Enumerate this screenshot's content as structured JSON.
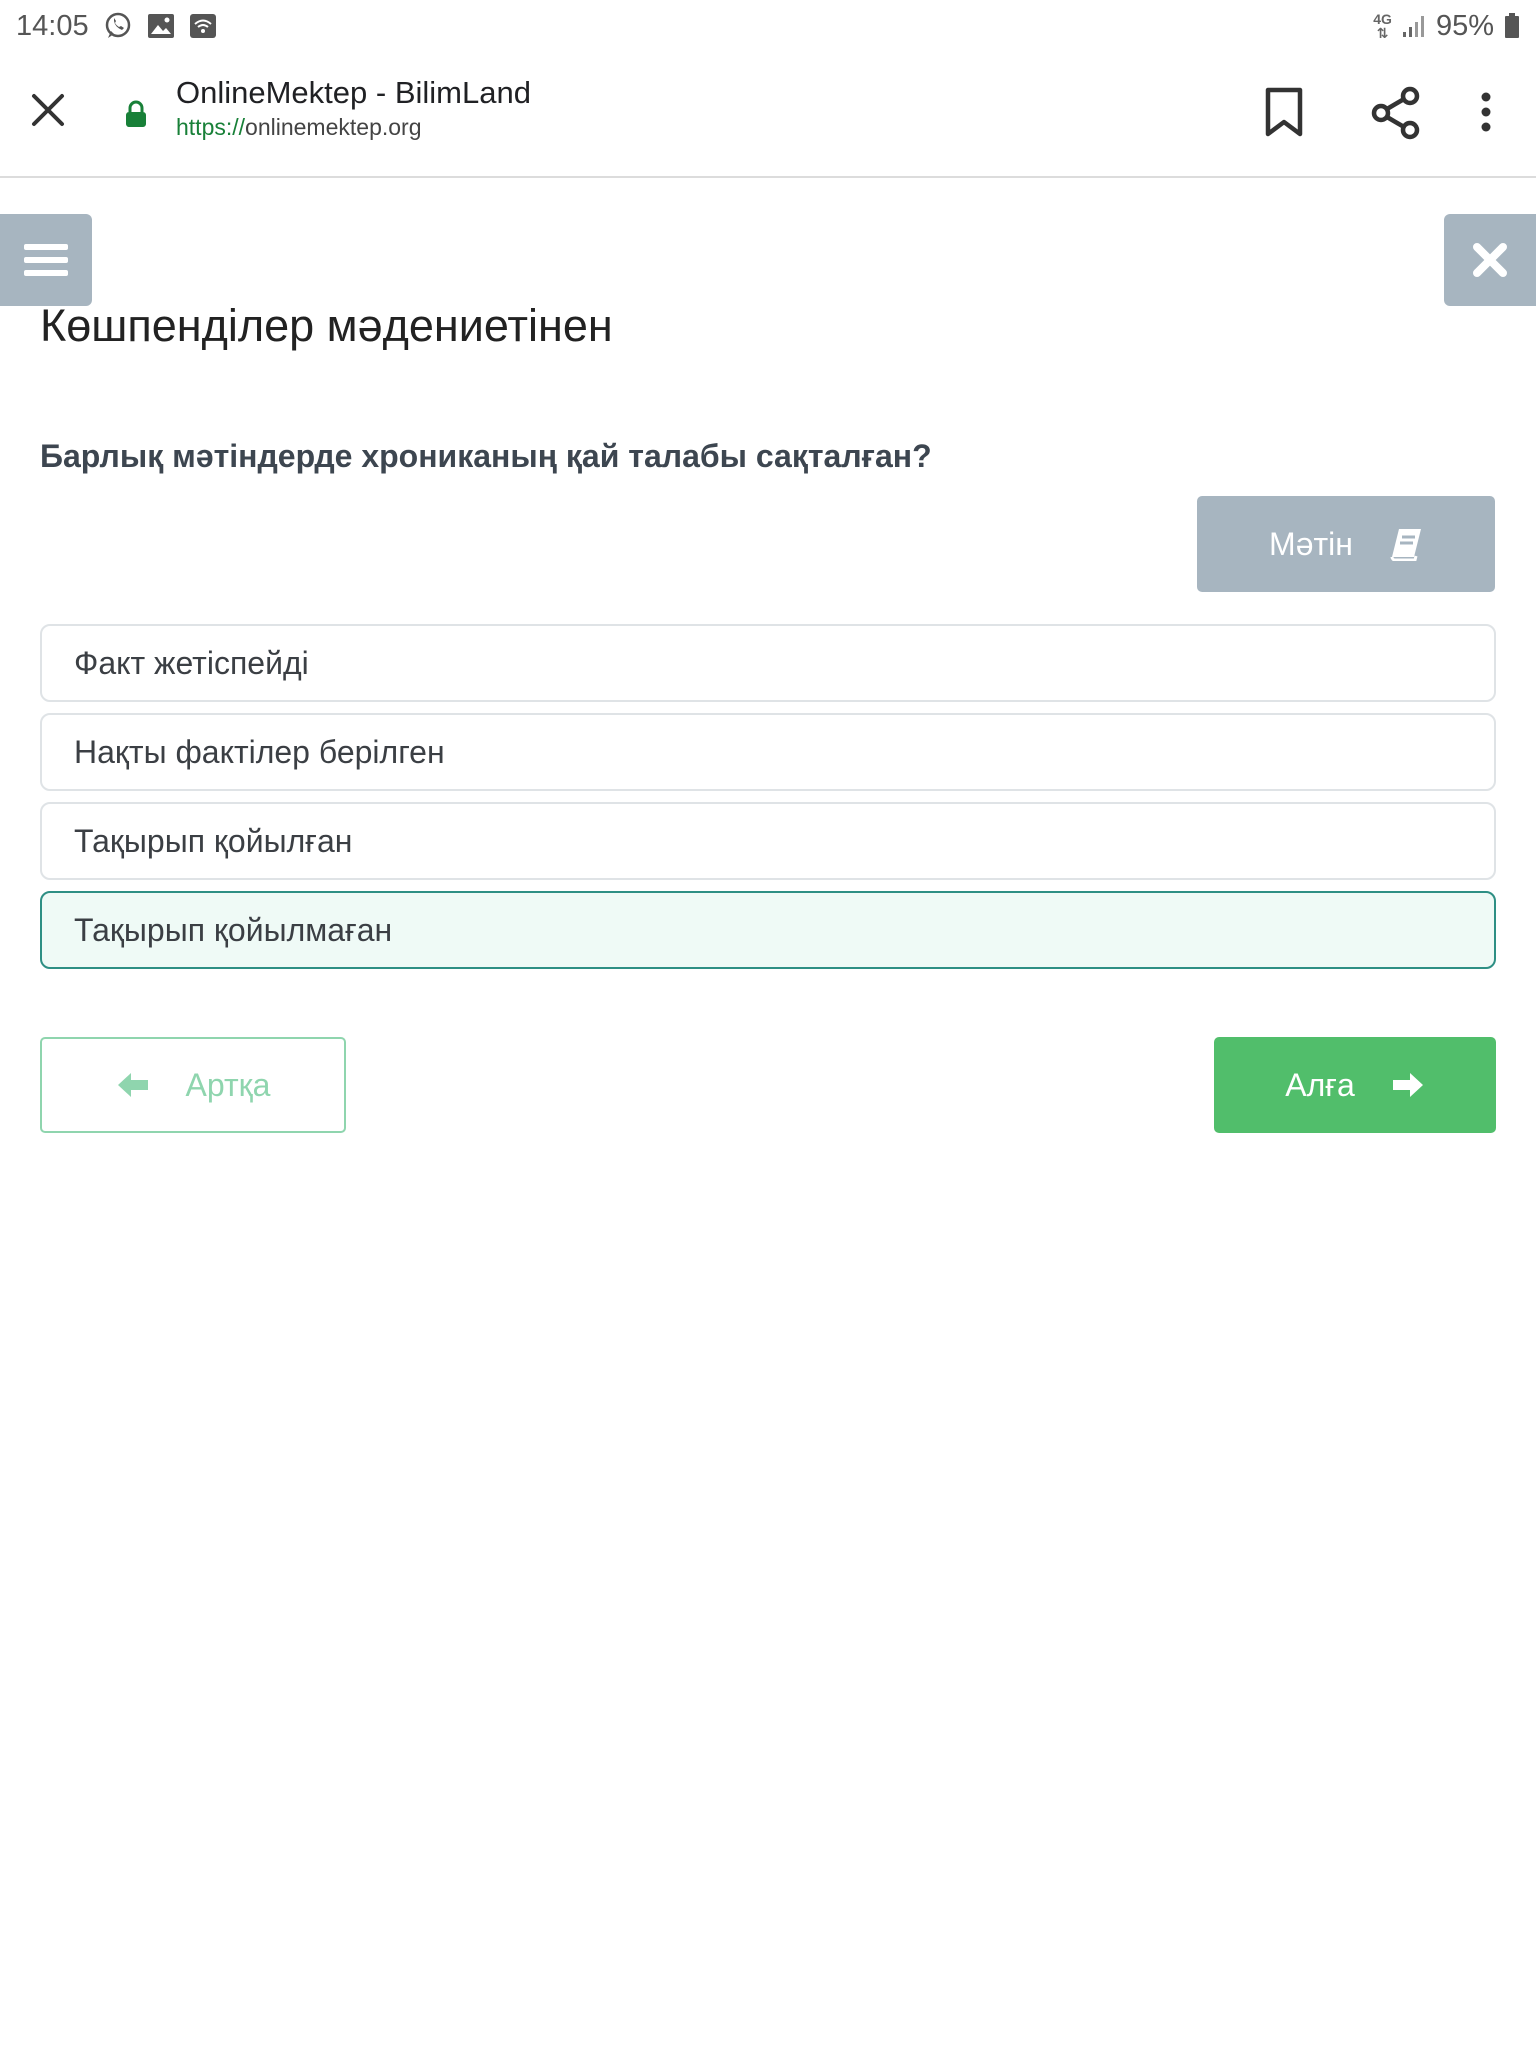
{
  "status_bar": {
    "time": "14:05",
    "network": "4G",
    "battery": "95%",
    "icons": [
      "whatsapp-icon",
      "gallery-icon",
      "wifi-icon",
      "signal-icon",
      "battery-icon"
    ]
  },
  "browser": {
    "page_title": "OnlineMektep - BilimLand",
    "url_scheme": "https://",
    "url_host": "onlinemektep.org",
    "icons": [
      "close-icon",
      "lock-icon",
      "bookmark-icon",
      "share-icon",
      "more-vert-icon"
    ]
  },
  "lesson": {
    "title": "Көшпенділер мәдениетінен",
    "question": "Барлық мәтіндерде хрониканың қай талабы сақталған?",
    "text_button": "Мәтін",
    "options": [
      "Факт жетіспейді",
      "Нақты фактілер берілген",
      "Тақырып қойылған",
      "Тақырып қойылмаған"
    ],
    "selected_option": "Тақырып қойылмаған",
    "back_button": "Артқа",
    "next_button": "Алға"
  },
  "colors": {
    "menu_buttons": "#a7b5c0",
    "selected_border": "#2e8f84",
    "selected_background": "#effaf6",
    "next_button": "#51be6b",
    "back_button": "#8fd5ae"
  }
}
